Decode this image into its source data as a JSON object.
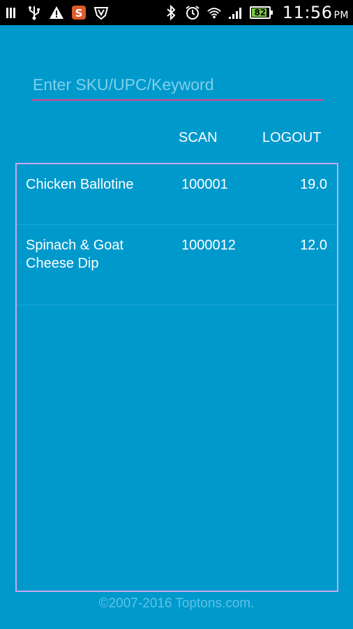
{
  "status_bar": {
    "time": "11:56",
    "ampm": "PM",
    "battery_level": "82",
    "icons_left": [
      "signal-bars-icon",
      "usb-icon",
      "warning-icon",
      "sms-app-icon",
      "shield-app-icon"
    ],
    "icons_right": [
      "bluetooth-icon",
      "alarm-icon",
      "wifi-icon",
      "cell-signal-icon",
      "battery-icon"
    ]
  },
  "search": {
    "placeholder": "Enter SKU/UPC/Keyword",
    "value": ""
  },
  "actions": {
    "scan_label": "SCAN",
    "logout_label": "LOGOUT"
  },
  "products": [
    {
      "name": "Chicken Ballotine",
      "sku": "100001",
      "price": "19.0"
    },
    {
      "name": "Spinach & Goat Cheese Dip",
      "sku": "1000012",
      "price": "12.0"
    }
  ],
  "footer": {
    "copyright": "©2007-2016 Toptons.com."
  },
  "colors": {
    "background": "#0099cc",
    "input_underline": "#e0408a",
    "list_border": "#c9a6f0",
    "battery_fill": "#7ac943"
  }
}
